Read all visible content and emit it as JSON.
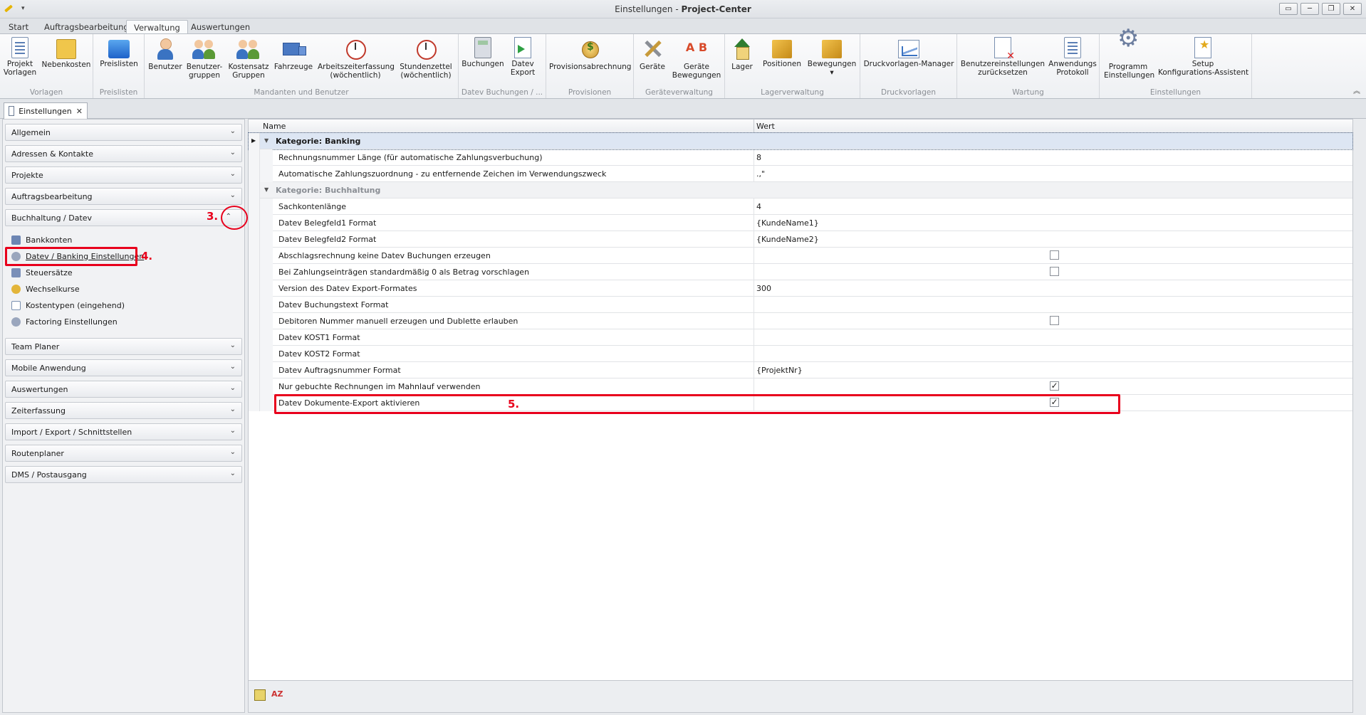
{
  "window": {
    "title_prefix": "Einstellungen - ",
    "title_app": "Project-Center",
    "buttons": [
      "▭",
      "─",
      "❐",
      "✕"
    ]
  },
  "tabs": [
    "Start",
    "Auftragsbearbeitung",
    "Verwaltung",
    "Auswertungen"
  ],
  "active_tab": "Verwaltung",
  "ribbon": {
    "groups": [
      {
        "label": "Vorlagen",
        "buttons": [
          {
            "label": "Projekt\nVorlagen",
            "icon": "document-icon"
          },
          {
            "label": "Nebenkosten",
            "icon": "folder-icon"
          }
        ]
      },
      {
        "label": "Preislisten",
        "buttons": [
          {
            "label": "Preislisten",
            "icon": "price-box-icon"
          }
        ]
      },
      {
        "label": "Mandanten und Benutzer",
        "buttons": [
          {
            "label": "Benutzer",
            "icon": "user-icon"
          },
          {
            "label": "Benutzer-\ngruppen",
            "icon": "user-group-icon"
          },
          {
            "label": "Kostensatz\nGruppen",
            "icon": "cost-group-icon"
          },
          {
            "label": "Fahrzeuge",
            "icon": "truck-icon"
          },
          {
            "label": "Arbeitszeiterfassung\n(wöchentlich)",
            "icon": "clock-icon"
          },
          {
            "label": "Stundenzettel\n(wöchentlich)",
            "icon": "clock-icon"
          }
        ]
      },
      {
        "label": "Datev Buchungen / ...",
        "buttons": [
          {
            "label": "Buchungen",
            "icon": "calculator-icon"
          },
          {
            "label": "Datev\nExport",
            "icon": "export-icon"
          }
        ]
      },
      {
        "label": "Provisionen",
        "buttons": [
          {
            "label": "Provisionsabrechnung",
            "icon": "coins-icon"
          }
        ]
      },
      {
        "label": "Geräteverwaltung",
        "buttons": [
          {
            "label": "Geräte",
            "icon": "tools-icon"
          },
          {
            "label": "Geräte\nBewegungen",
            "icon": "ab-icon"
          }
        ]
      },
      {
        "label": "Lagerverwaltung",
        "buttons": [
          {
            "label": "Lager",
            "icon": "house-icon"
          },
          {
            "label": "Positionen",
            "icon": "cube-icon"
          },
          {
            "label": "Bewegungen\n▾",
            "icon": "cube-icon"
          }
        ]
      },
      {
        "label": "Druckvorlagen",
        "buttons": [
          {
            "label": "Druckvorlagen-Manager",
            "icon": "chart-icon"
          }
        ]
      },
      {
        "label": "Wartung",
        "buttons": [
          {
            "label": "Benutzereinstellungen\nzurücksetzen",
            "icon": "reset-icon"
          },
          {
            "label": "Anwendungs\nProtokoll",
            "icon": "protocol-icon"
          }
        ]
      },
      {
        "label": "Einstellungen",
        "buttons": [
          {
            "label": "Programm\nEinstellungen",
            "icon": "gear-icon"
          },
          {
            "label": "Setup\nKonfigurations-Assistent",
            "icon": "wizard-icon"
          }
        ]
      }
    ],
    "collapse": "︽"
  },
  "document_tab": {
    "label": "Einstellungen",
    "close": "✕"
  },
  "sidebar": {
    "sections_top": [
      "Allgemein",
      "Adressen & Kontakte",
      "Projekte",
      "Auftragsbearbeitung",
      "Buchhaltung / Datev"
    ],
    "sub_items": [
      "Bankkonten",
      "Datev / Banking Einstellungen",
      "Steuersätze",
      "Wechselkurse",
      "Kostentypen (eingehend)",
      "Factoring Einstellungen"
    ],
    "sections_bottom": [
      "Team Planer",
      "Mobile Anwendung",
      "Auswertungen",
      "Zeiterfassung",
      "Import / Export / Schnittstellen",
      "Routenplaner",
      "DMS / Postausgang"
    ],
    "chevron_down": "⌄",
    "chevron_up": "⌃"
  },
  "annotations": [
    "3.",
    "4.",
    "5."
  ],
  "grid": {
    "columns": [
      "Name",
      "Wert"
    ],
    "rows": [
      {
        "type": "category",
        "name": "Kategorie: Banking",
        "selected": true
      },
      {
        "type": "item",
        "name": "Rechnungsnummer Länge (für automatische Zahlungsverbuchung)",
        "value": "8"
      },
      {
        "type": "item",
        "name": "Automatische Zahlungszuordnung - zu entfernende Zeichen im Verwendungszweck",
        "value": ".,\""
      },
      {
        "type": "category",
        "name": "Kategorie: Buchhaltung",
        "selected": false
      },
      {
        "type": "item",
        "name": "Sachkontenlänge",
        "value": "4"
      },
      {
        "type": "item",
        "name": "Datev Belegfeld1 Format",
        "value": "{KundeName1}"
      },
      {
        "type": "item",
        "name": "Datev Belegfeld2 Format",
        "value": "{KundeName2}"
      },
      {
        "type": "check",
        "name": "Abschlagsrechnung keine Datev Buchungen erzeugen",
        "checked": false
      },
      {
        "type": "check",
        "name": "Bei Zahlungseinträgen standardmäßig 0 als Betrag vorschlagen",
        "checked": false
      },
      {
        "type": "item",
        "name": "Version des Datev Export-Formates",
        "value": "300"
      },
      {
        "type": "item",
        "name": "Datev Buchungstext Format",
        "value": ""
      },
      {
        "type": "check",
        "name": "Debitoren Nummer manuell erzeugen und Dublette erlauben",
        "checked": false
      },
      {
        "type": "item",
        "name": "Datev KOST1 Format",
        "value": ""
      },
      {
        "type": "item",
        "name": "Datev KOST2 Format",
        "value": ""
      },
      {
        "type": "item",
        "name": "Datev Auftragsnummer Format",
        "value": "{ProjektNr}"
      },
      {
        "type": "check",
        "name": "Nur gebuchte Rechnungen im Mahnlauf verwenden",
        "checked": true
      },
      {
        "type": "check",
        "name": "Datev Dokumente-Export aktivieren",
        "checked": true
      }
    ]
  }
}
